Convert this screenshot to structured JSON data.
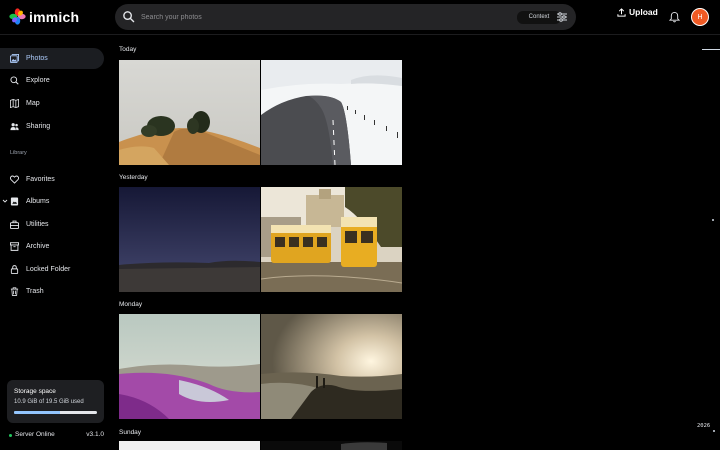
{
  "app": {
    "name": "immich"
  },
  "search": {
    "placeholder": "Search your photos",
    "context_label": "Context"
  },
  "header": {
    "upload_label": "Upload",
    "avatar_initial": "H"
  },
  "sidebar": {
    "items": [
      {
        "label": "Photos",
        "icon": "photos-icon",
        "active": true
      },
      {
        "label": "Explore",
        "icon": "explore-icon"
      },
      {
        "label": "Map",
        "icon": "map-icon"
      },
      {
        "label": "Sharing",
        "icon": "sharing-icon"
      }
    ],
    "library_label": "Library",
    "library_items": [
      {
        "label": "Favorites",
        "icon": "heart-icon"
      },
      {
        "label": "Albums",
        "icon": "albums-icon"
      },
      {
        "label": "Utilities",
        "icon": "utilities-icon"
      },
      {
        "label": "Archive",
        "icon": "archive-icon"
      },
      {
        "label": "Locked Folder",
        "icon": "lock-icon"
      },
      {
        "label": "Trash",
        "icon": "trash-icon"
      }
    ],
    "storage": {
      "title": "Storage space",
      "used_text": "10.9 GiB of 19.5 GiB used",
      "used_fraction": 0.56
    },
    "status": {
      "text": "Server Online",
      "version": "v3.1.0"
    }
  },
  "groups": [
    {
      "title": "Today"
    },
    {
      "title": "Yesterday"
    },
    {
      "title": "Monday"
    },
    {
      "title": "Sunday"
    }
  ],
  "scrubber": {
    "year": "2026"
  },
  "colors": {
    "accent": "#adcbfa",
    "avatar": "#f05a24",
    "online": "#22c55e"
  }
}
